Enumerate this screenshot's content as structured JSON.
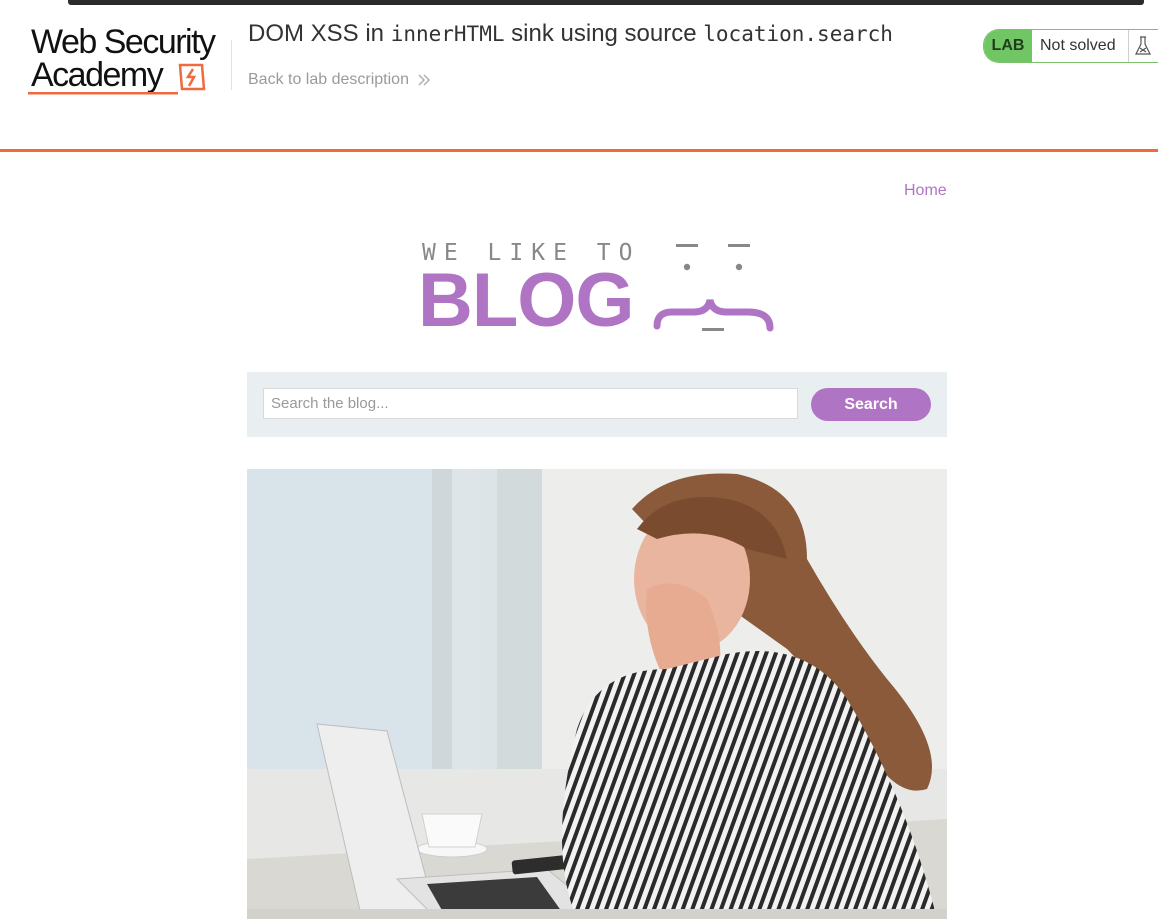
{
  "header": {
    "logo": {
      "line1": "Web Security",
      "line2": "Academy"
    },
    "lab_title_prefix": "DOM XSS in ",
    "lab_title_code1": "innerHTML",
    "lab_title_mid": " sink using source ",
    "lab_title_code2": "location.search",
    "back_link_label": "Back to lab description",
    "lab_badge": "LAB",
    "status": "Not solved",
    "colors": {
      "accent": "#ef6a3d",
      "solved_green": "#70c665"
    }
  },
  "nav": {
    "home_label": "Home"
  },
  "blog_logo": {
    "tagline": "WE LIKE TO",
    "word": "BLOG",
    "color": "#b074c4"
  },
  "search": {
    "placeholder": "Search the blog...",
    "value": "",
    "button_label": "Search"
  },
  "post": {
    "image_icon": "woman-shocked-at-laptop-photo"
  }
}
